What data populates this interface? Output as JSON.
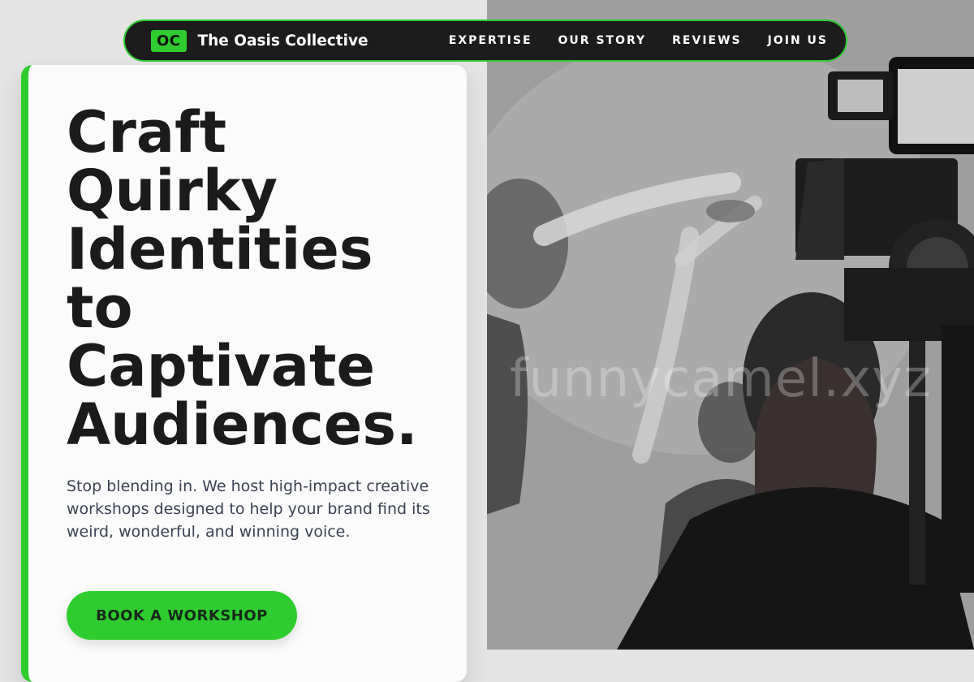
{
  "header": {
    "logo_badge": "OC",
    "brand_name": "The Oasis Collective",
    "nav": [
      "EXPERTISE",
      "OUR STORY",
      "REVIEWS",
      "JOIN US"
    ]
  },
  "hero": {
    "title_lines": [
      "Craft",
      "Quirky",
      "Identities",
      "to",
      "Captivate",
      "Audiences."
    ],
    "body": "Stop blending in. We host high-impact creative workshops designed to help your brand find its weird, wonderful, and winning voice.",
    "cta_label": "BOOK A WORKSHOP"
  },
  "image": {
    "watermark": "funnycamel.xyz",
    "description_icon": "film-camera-photo"
  },
  "colors": {
    "accent": "#2ecc2e",
    "nav_bg": "#1c1c1c",
    "heading": "#1b1b1b",
    "body_text": "#3b4252"
  }
}
